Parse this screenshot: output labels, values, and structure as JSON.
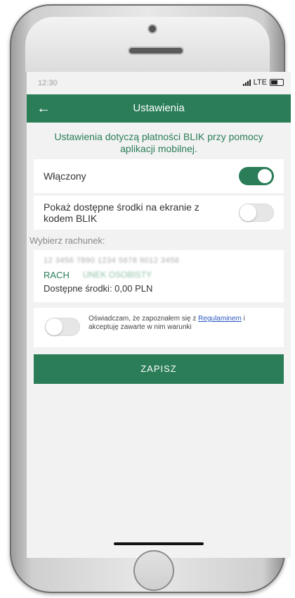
{
  "status_bar": {
    "time": "12:30",
    "network": "LTE"
  },
  "app_bar": {
    "back_icon": "arrow-left-icon",
    "title": "Ustawienia"
  },
  "info_text": "Ustawienia dotyczą płatności BLIK przy pomocy aplikacji mobilnej.",
  "settings": {
    "enabled": {
      "label": "Włączony",
      "value": true
    },
    "show_funds": {
      "label": "Pokaż dostępne środki na ekranie z kodem BLIK",
      "value": false
    }
  },
  "account_section": {
    "label": "Wybierz rachunek:",
    "account_number": "12 3456 7890 1234 5678 9012 3456",
    "account_name": "RACH",
    "account_name_rest": "UNEK OSOBISTY",
    "balance_label": "Dostępne środki: 0,00 PLN"
  },
  "terms": {
    "value": false,
    "text_before": "Oświadczam, że zapoznałem się z ",
    "link": "Regulaminem",
    "text_after": " i akceptuję zawarte w nim warunki"
  },
  "save_button": "ZAPISZ",
  "colors": {
    "brand": "#2a7d57",
    "link": "#2a55c0"
  }
}
